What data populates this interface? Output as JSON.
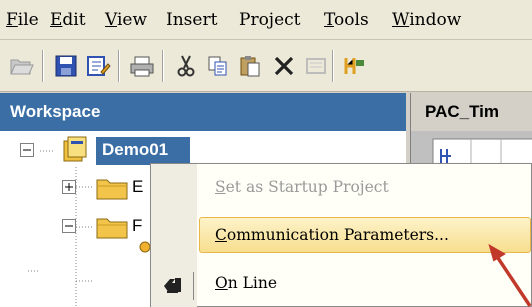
{
  "menubar": {
    "items": [
      {
        "pre": "",
        "ul": "F",
        "post": "ile"
      },
      {
        "pre": "",
        "ul": "E",
        "post": "dit"
      },
      {
        "pre": "",
        "ul": "V",
        "post": "iew"
      },
      {
        "pre": "Insert",
        "ul": "",
        "post": ""
      },
      {
        "pre": "Project",
        "ul": "",
        "post": ""
      },
      {
        "pre": "",
        "ul": "T",
        "post": "ools"
      },
      {
        "pre": "",
        "ul": "W",
        "post": "indow"
      }
    ]
  },
  "toolbar": {
    "buttons": [
      "open-icon",
      "save-icon",
      "edit-icon",
      "print-icon",
      "cut-icon",
      "copy-icon",
      "paste-icon",
      "delete-icon",
      "disabled-icon",
      "build-icon"
    ]
  },
  "workspace": {
    "title": "Workspace",
    "project": "Demo01",
    "child1_label": "E",
    "child2_label": "F"
  },
  "editor": {
    "tab_title": "PAC_Tim"
  },
  "context_menu": {
    "item1": {
      "ul": "S",
      "rest": "et as Startup Project"
    },
    "item2": {
      "ul": "C",
      "rest": "ommunication Parameters..."
    },
    "item3": {
      "ul": "O",
      "rest": "n Line"
    }
  },
  "colors": {
    "title_blue": "#3a6ea5",
    "highlight": "#f7de8f",
    "arrow": "#c0392b"
  }
}
